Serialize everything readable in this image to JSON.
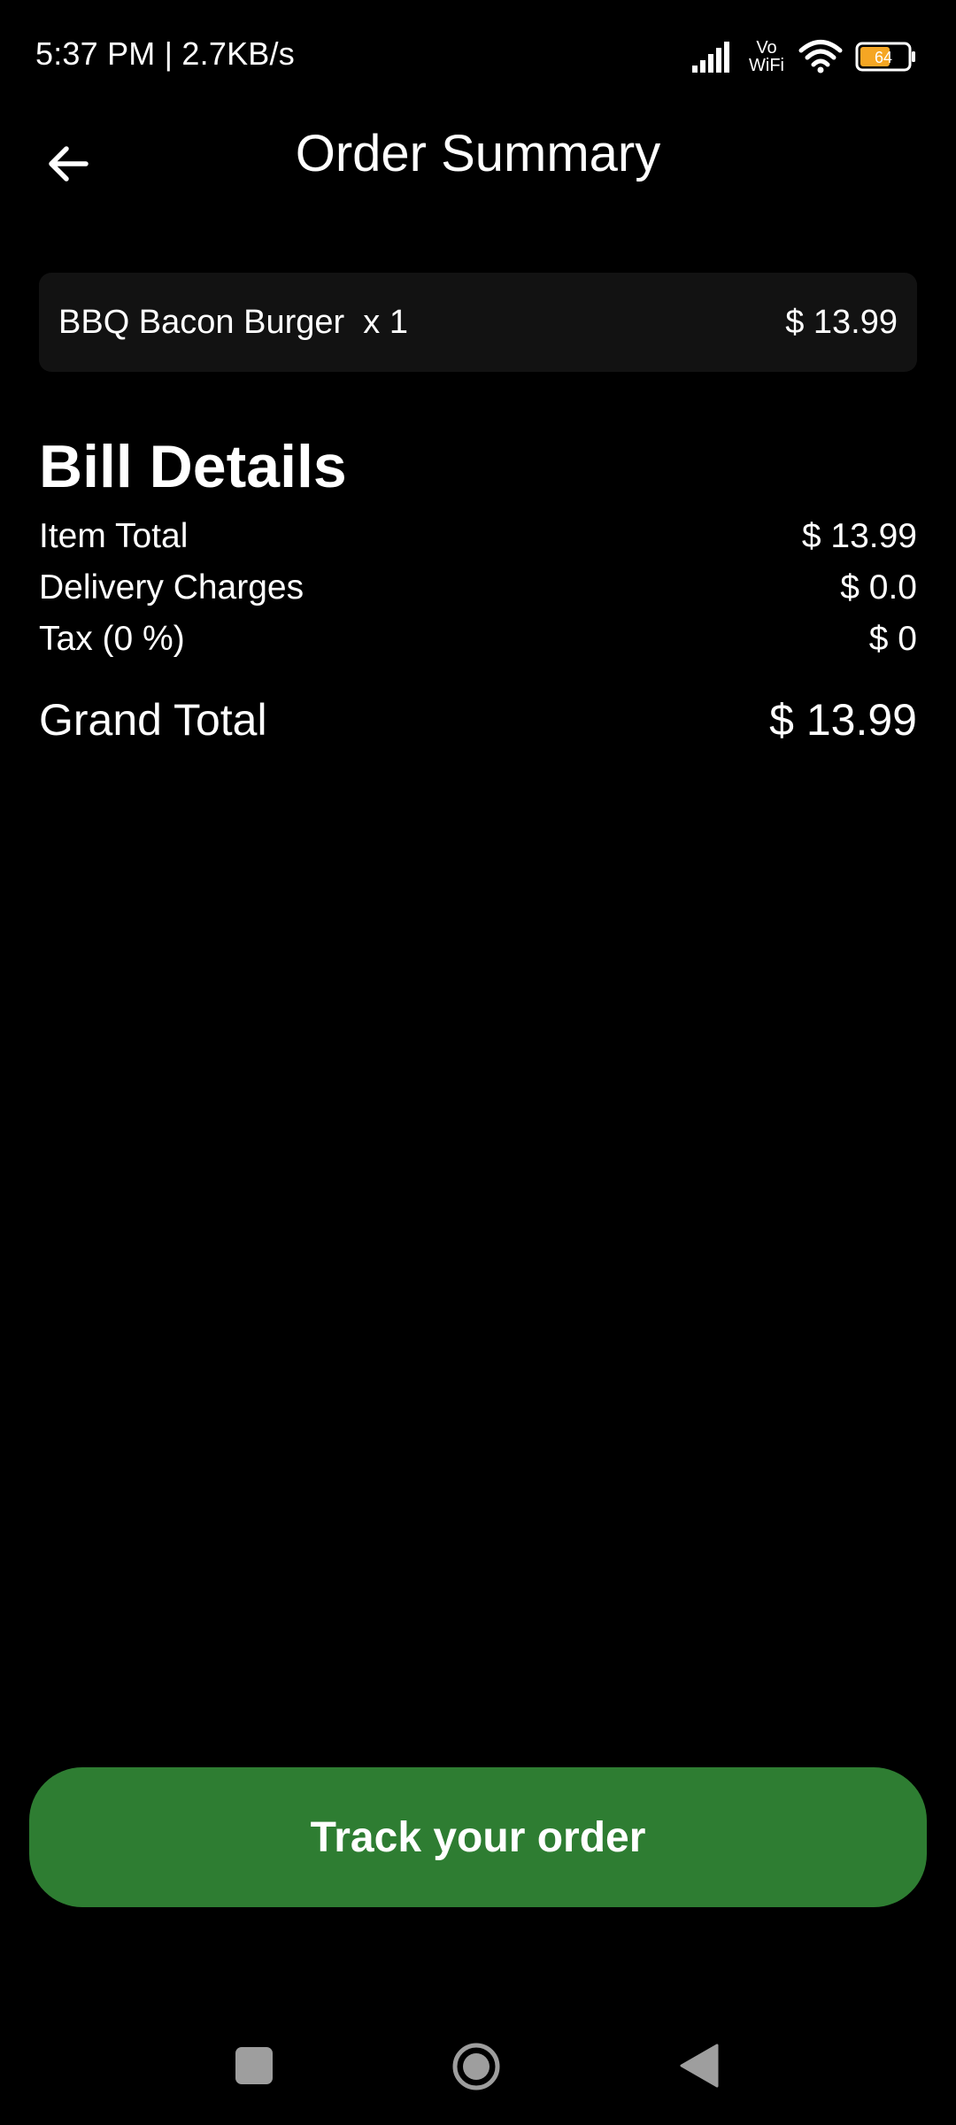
{
  "status_bar": {
    "left_text": "5:37 PM | 2.7KB/s",
    "vowifi_top": "Vo",
    "vowifi_bottom": "WiFi",
    "battery_level": "64",
    "battery_color": "#f5a623"
  },
  "header": {
    "title": "Order Summary",
    "back_icon": "arrow-left-icon"
  },
  "order_items": [
    {
      "name": "BBQ Bacon Burger  x 1",
      "price": "$ 13.99"
    }
  ],
  "bill": {
    "title": "Bill Details",
    "rows": [
      {
        "label": "Item Total",
        "value": "$ 13.99"
      },
      {
        "label": "Delivery Charges",
        "value": "$ 0.0"
      },
      {
        "label": "Tax (0 %)",
        "value": "$ 0"
      }
    ],
    "grand_total": {
      "label": "Grand Total",
      "value": "$ 13.99"
    }
  },
  "actions": {
    "track_label": "Track your order",
    "track_color": "#2e7d32"
  },
  "nav_bar": {
    "recents_icon": "square-icon",
    "home_icon": "circle-icon",
    "back_icon": "triangle-back-icon"
  }
}
